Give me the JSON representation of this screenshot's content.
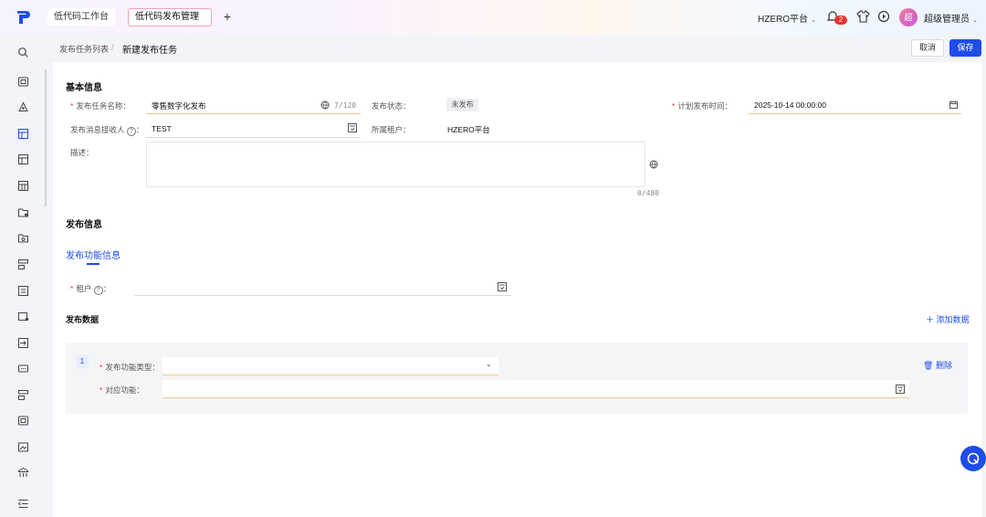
{
  "header": {
    "tabs": [
      "低代码工作台",
      "低代码发布管理"
    ],
    "add_tab": "+",
    "tenant": "HZERO平台",
    "notification_count": "2",
    "avatar_text": "超",
    "username": "超级管理员"
  },
  "breadcrumb": {
    "parent": "发布任务列表",
    "separator": "/",
    "current": "新建发布任务"
  },
  "actions": {
    "cancel": "取消",
    "save": "保存"
  },
  "basic_info": {
    "title": "基本信息",
    "task_name_label": "发布任务名称：",
    "task_name_value": "零售数字化发布",
    "task_name_count": "7/120",
    "status_label": "发布状态：",
    "status_value": "未发布",
    "plan_time_label": "计划发布时间：",
    "plan_time_value": "2025-10-14 00:00:00",
    "receiver_label": "发布消息接收人",
    "receiver_value": "TEST",
    "tenant_label": "所属租户：",
    "tenant_value": "HZERO平台",
    "desc_label": "描述：",
    "desc_count": "0/480"
  },
  "publish_info": {
    "title": "发布信息",
    "subtab": "发布功能信息",
    "tenant_label": "租户",
    "data_title": "发布数据",
    "add_data": "添加数据",
    "rows": [
      {
        "index": "1",
        "type_label": "发布功能类型：",
        "func_label": "对应功能：",
        "delete": "删除"
      }
    ]
  },
  "colors": {
    "primary": "#1e4de8",
    "required": "#e8312e"
  }
}
